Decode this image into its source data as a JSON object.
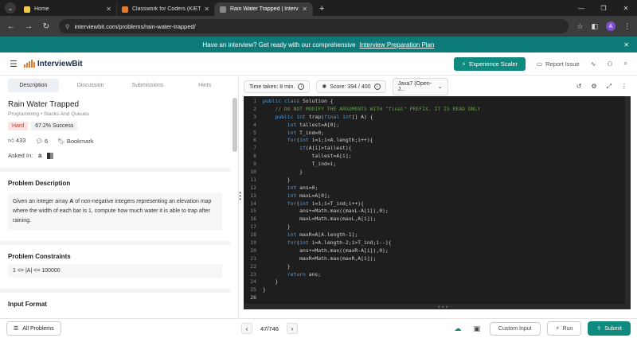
{
  "browser": {
    "tabs": [
      {
        "title": "Home",
        "favicon_color": "#f2c94c"
      },
      {
        "title": "Classwork for Coders (KIET)",
        "favicon_color": "#e07b2e"
      },
      {
        "title": "Rain Water Trapped | InterviewB",
        "favicon_color": "#888888",
        "active": true
      }
    ],
    "url": "interviewbit.com/problems/rain-water-trapped/",
    "avatar_letter": "A"
  },
  "banner": {
    "text": "Have an interview? Get ready with our comprehensive",
    "link": "Interview Preparation Plan"
  },
  "header": {
    "logo": "InterviewBit",
    "scaler_button": "Experience Scaler",
    "report": "Report Issue"
  },
  "subtabs": [
    "Description",
    "Discussion",
    "Submissions",
    "Hints"
  ],
  "problem": {
    "title": "Rain Water Trapped",
    "breadcrumb": "Programming • Stacks And Queues",
    "difficulty": "Hard",
    "success": "67.2% Success",
    "likes": "433",
    "views": "6",
    "bookmark": "Bookmark",
    "asked_in": "Asked In:",
    "desc_heading": "Problem Description",
    "desc_pre": "Given an integer array ",
    "desc_bold": "A",
    "desc_post": " of non-negative integers representing an elevation map where the width of each bar is 1, compute how much water it is able to trap after raining.",
    "constraints_heading": "Problem Constraints",
    "constraint_text": "1 <= |A| <= 100000",
    "input_heading": "Input Format"
  },
  "toolbar": {
    "time_taken": "Time taken: 8 min.",
    "score": "Score: 394 / 400",
    "language": "Java7 (Open-J..."
  },
  "code_lines": [
    "public class Solution {",
    "    // DO NOT MODIFY THE ARGUMENTS WITH \"final\" PREFIX. IT IS READ ONLY",
    "    public int trap(final int[] A) {",
    "        int tallest=A[0];",
    "        int T_ind=0;",
    "        for(int i=1;i<A.length;i++){",
    "            if(A[i]>tallest){",
    "                tallest=A[i];",
    "                T_ind=i;",
    "            }",
    "        }",
    "        int ans=0;",
    "        int maxL=A[0];",
    "        for(int i=1;i<T_ind;i++){",
    "            ans+=Math.max((maxL-A[i]),0);",
    "            maxL=Math.max(maxL,A[i]);",
    "        }",
    "        int maxR=A[A.length-1];",
    "        for(int i=A.length-2;i>T_ind;i--){",
    "            ans+=Math.max((maxR-A[i]),0);",
    "            maxR=Math.max(maxR,A[i]);",
    "        }",
    "        return ans;",
    "    }",
    "}",
    ""
  ],
  "bottom": {
    "all_problems": "All Problems",
    "pager": "47/746",
    "custom_input": "Custom Input",
    "run": "Run",
    "submit": "Submit"
  },
  "colors": {
    "brand_teal": "#0e8a7e",
    "banner": "#0e7b7b",
    "hard_badge": "#c0392b"
  }
}
